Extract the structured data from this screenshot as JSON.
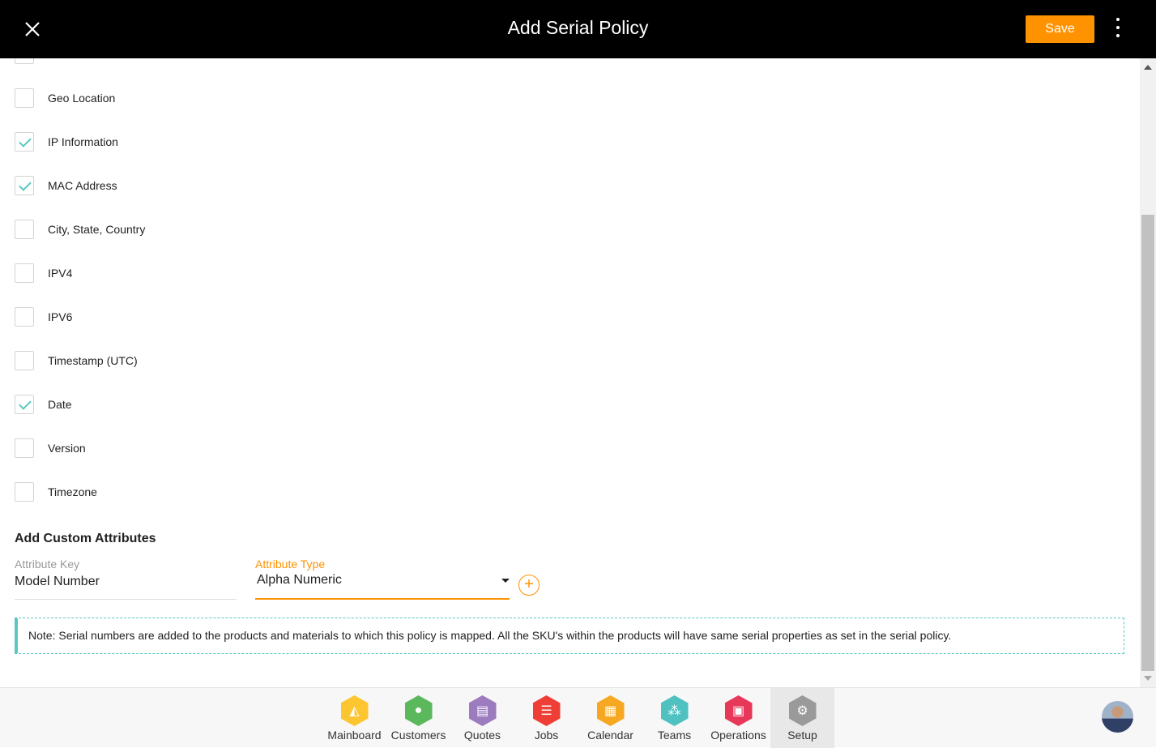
{
  "header": {
    "title": "Add Serial Policy",
    "save_label": "Save"
  },
  "checkboxes": [
    {
      "label": "",
      "checked": false
    },
    {
      "label": "Geo Location",
      "checked": false
    },
    {
      "label": "IP Information",
      "checked": true
    },
    {
      "label": "MAC Address",
      "checked": true
    },
    {
      "label": "City, State, Country",
      "checked": false
    },
    {
      "label": "IPV4",
      "checked": false
    },
    {
      "label": "IPV6",
      "checked": false
    },
    {
      "label": "Timestamp (UTC)",
      "checked": false
    },
    {
      "label": "Date",
      "checked": true
    },
    {
      "label": "Version",
      "checked": false
    },
    {
      "label": "Timezone",
      "checked": false
    }
  ],
  "custom": {
    "title": "Add Custom Attributes",
    "key_label": "Attribute Key",
    "key_value": "Model Number",
    "type_label": "Attribute Type",
    "type_value": "Alpha Numeric"
  },
  "note": "Note: Serial numbers are added to the products and materials to which this policy is mapped. All the SKU's within the products will have same serial properties as set in the serial policy.",
  "nav": [
    {
      "label": "Mainboard",
      "icon": "mainboard-icon",
      "color": "#fdc52f",
      "glyph": "◭"
    },
    {
      "label": "Customers",
      "icon": "user-icon",
      "color": "#5cb85c",
      "glyph": "●"
    },
    {
      "label": "Quotes",
      "icon": "quotes-icon",
      "color": "#9c7bbf",
      "glyph": "▤"
    },
    {
      "label": "Jobs",
      "icon": "list-icon",
      "color": "#ef3e36",
      "glyph": "☰"
    },
    {
      "label": "Calendar",
      "icon": "calendar-icon",
      "color": "#f7a823",
      "glyph": "▦"
    },
    {
      "label": "Teams",
      "icon": "teams-icon",
      "color": "#4fc1c1",
      "glyph": "⁂"
    },
    {
      "label": "Operations",
      "icon": "briefcase-icon",
      "color": "#e8385a",
      "glyph": "▣"
    },
    {
      "label": "Setup",
      "icon": "gear-icon",
      "color": "#9a9a9a",
      "glyph": "⚙",
      "active": true
    }
  ]
}
